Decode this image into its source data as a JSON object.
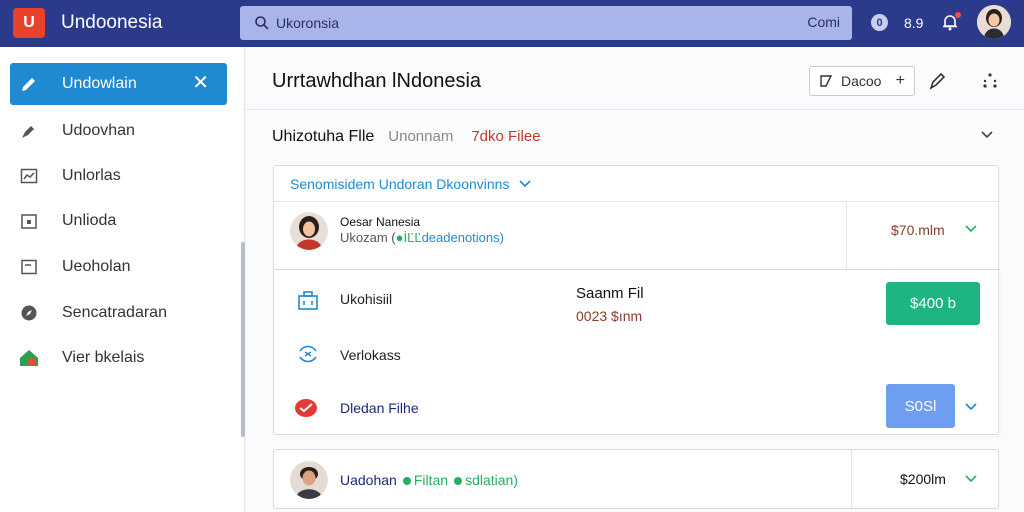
{
  "app": {
    "logo_text": "U",
    "title": "Undoonesia"
  },
  "search": {
    "value": "Ukoronsia",
    "button_label": "Comi"
  },
  "topbar": {
    "coin_label": "0",
    "count": "8.9"
  },
  "sidebar": {
    "items": [
      {
        "label": "Undowlain",
        "icon": "edit-icon"
      },
      {
        "label": "Udoovhan",
        "icon": "pin-icon"
      },
      {
        "label": "Unlorlas",
        "icon": "chart-icon"
      },
      {
        "label": "Unlioda",
        "icon": "calendar-icon"
      },
      {
        "label": "Ueoholan",
        "icon": "doc-icon"
      },
      {
        "label": "Sencatradaran",
        "icon": "compass-icon"
      },
      {
        "label": "Vier bkelais",
        "icon": "house-icon"
      }
    ]
  },
  "main": {
    "title": "Urrtawhdhan lNdonesia",
    "header_button": "Dacoo",
    "tabs": [
      "Uhizotuha Flle",
      "Unonnam",
      "7dko Filee"
    ],
    "section_link": "Senomisidem Undoran Dkoonvinns",
    "row1": {
      "name": "Oesar Nanesia",
      "sub_prefix": "Ukozam (",
      "sub_green": "●İĽĽ",
      "sub_blue": "deadenotions)",
      "amount": "$70.mlm"
    },
    "actions": [
      {
        "label": "Ukohisiil",
        "icon": "briefcase-icon"
      },
      {
        "label": "Verlokass",
        "icon": "exchange-icon"
      },
      {
        "label": "Dledan Filhe",
        "icon": "youtube-icon"
      }
    ],
    "fee": {
      "label": "Saanm Fil",
      "amount": "0023 $ınm"
    },
    "green_button": "$400 b",
    "blue_button": "S0Sl",
    "row2": {
      "label_main": "Uadohan",
      "label_green1": "Filtan",
      "label_green2": "sdlatian)",
      "amount": "$200lm"
    }
  },
  "colors": {
    "topbar": "#2c3a8c",
    "accent": "#1f8ad1",
    "green": "#1db584",
    "blue_button": "#6d9ef0",
    "logo": "#e8412c"
  }
}
